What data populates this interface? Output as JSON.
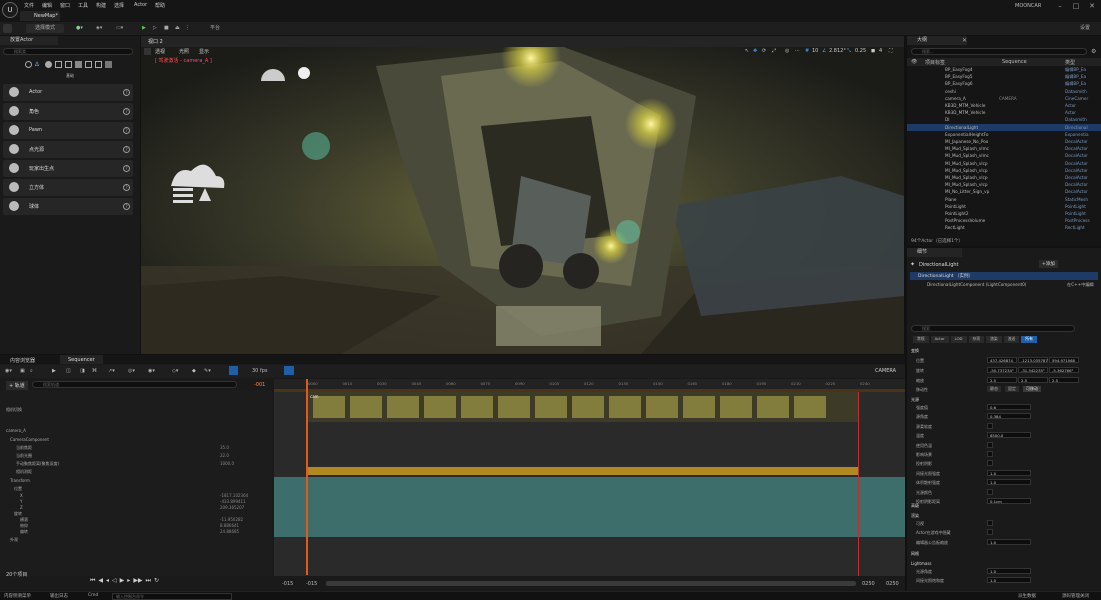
{
  "app": {
    "logo": "U",
    "map_tab": "NewMap*",
    "project": "MOONCAR"
  },
  "menu": [
    "文件",
    "编辑",
    "窗口",
    "工具",
    "构建",
    "选择",
    "Actor",
    "帮助"
  ],
  "toolbar": {
    "mode": "选择模式",
    "platform": "平台",
    "settings": "设置"
  },
  "left_panel": {
    "tab": "放置Actor",
    "search_placeholder": "搜索类",
    "category_label": "基础",
    "items": [
      "Actor",
      "角色",
      "Pawn",
      "点光源",
      "玩家出生点",
      "立方体",
      "球体"
    ]
  },
  "viewport": {
    "tab": "视口 2",
    "view_mode": "透视",
    "lighting": "光照",
    "show": "显示",
    "pilot_label": "[ 驾驶激活 - camera_A ]",
    "fov": "2.812°",
    "speed": "0.25",
    "grid": "10",
    "cam_index": "4"
  },
  "outliner": {
    "tab": "大纲",
    "search_placeholder": "搜索...",
    "col_item": "项目标签",
    "col_seq": "Sequence",
    "col_type": "类型",
    "rows": [
      {
        "name": "BP_EasyFog4",
        "type": "编辑BP_Ea"
      },
      {
        "name": "BP_EasyFog5",
        "type": "编辑BP_Ea"
      },
      {
        "name": "BP_EasyFog6",
        "type": "编辑BP_Ea"
      },
      {
        "name": "ceshi",
        "type": "Datasmith"
      },
      {
        "name": "camera_A",
        "type": "CineCamer",
        "seq": "CAMERA"
      },
      {
        "name": "KB3D_MTM_Vehicle",
        "type": "Actor"
      },
      {
        "name": "KB3D_MTM_Vehicle",
        "type": "Actor"
      },
      {
        "name": "DI",
        "type": "Datasmith"
      },
      {
        "name": "DirectionalLight",
        "type": "Directional"
      },
      {
        "name": "ExponentialHeightFo",
        "type": "Exponentia"
      },
      {
        "name": "MI_Japanese_No_Poo",
        "type": "DecalActor"
      },
      {
        "name": "MI_Mud_Splash_vlmc",
        "type": "DecalActor"
      },
      {
        "name": "MI_Mud_Splash_vlmc",
        "type": "DecalActor"
      },
      {
        "name": "MI_Mud_Splash_vlcp",
        "type": "DecalActor"
      },
      {
        "name": "MI_Mud_Splash_vlcp",
        "type": "DecalActor"
      },
      {
        "name": "MI_Mud_Splash_vlcp",
        "type": "DecalActor"
      },
      {
        "name": "MI_Mud_Splash_vlcp",
        "type": "DecalActor"
      },
      {
        "name": "MI_No_Litter_Sign_vp",
        "type": "DecalActor"
      },
      {
        "name": "Plane",
        "type": "StaticMesh"
      },
      {
        "name": "PointLight",
        "type": "PointLight"
      },
      {
        "name": "PointLight2",
        "type": "PointLight"
      },
      {
        "name": "PostProcessVolume",
        "type": "PostProcess"
      },
      {
        "name": "RectLight",
        "type": "RectLight"
      }
    ],
    "footer": "94个Actor（已选择1个）"
  },
  "details": {
    "tab": "细节",
    "actor": "DirectionalLight",
    "add_button": "+添加",
    "comp_root": "DirectionalLight （实例）",
    "comp_child": "DirectionalLightComponent (LightComponent0)",
    "edit_cpp": "在C++中编辑",
    "search_placeholder": "搜索",
    "filter_tabs": [
      "常规",
      "Actor",
      "LOD",
      "杂项",
      "渲染",
      "流送",
      "所有"
    ],
    "section_transform": "变换",
    "location": {
      "label": "位置",
      "x": "437.426874",
      "y": "-1213.035787",
      "z": "594.971068"
    },
    "rotation": {
      "label": "旋转",
      "x": "-50.737234°",
      "y": "-31.342235°",
      "z": "-5.362766°"
    },
    "scale": {
      "label": "缩放",
      "x": "2.5",
      "y": "2.5",
      "z": "2.5"
    },
    "mobility": {
      "label": "移动性",
      "a": "静态",
      "b": "固定",
      "c": "可移动"
    },
    "section_light": "光源",
    "light_props": [
      {
        "label": "强度值",
        "value": "0.6"
      },
      {
        "label": "源角度",
        "value": "0.384"
      },
      {
        "label": "源柔软度",
        "value": ""
      },
      {
        "label": "温度",
        "value": "6500.0"
      },
      {
        "label": "使用色温",
        "value": ""
      },
      {
        "label": "影响场景",
        "value": ""
      },
      {
        "label": "投射阴影",
        "value": ""
      },
      {
        "label": "间接光照强度",
        "value": "1.0"
      },
      {
        "label": "体积散射强度",
        "value": "1.0"
      },
      {
        "label": "光源颜色",
        "value": ""
      },
      {
        "label": "投射阴影距离",
        "value": "0.1cm"
      }
    ],
    "section_render": "渲染",
    "render_props": [
      {
        "label": "可视",
        "value": ""
      },
      {
        "label": "Actor在游戏中隐藏",
        "value": ""
      },
      {
        "label": "编辑器公告板缩放",
        "value": "1.0"
      }
    ],
    "section_lightmass": "Lightmass",
    "lightmass_props": [
      {
        "label": "光源角度",
        "value": "1.0"
      },
      {
        "label": "间接光照饱和度",
        "value": "1.0"
      }
    ],
    "section_physics": "高级",
    "section_anim": "网格"
  },
  "sequencer": {
    "tab_content": "内容浏览器",
    "tab_seq": "Sequencer",
    "fps": "30 fps",
    "track_button": "+ 轨道",
    "search_placeholder": "搜索轨道",
    "current_frame": "-001",
    "camera_dropdown": "CAMERA",
    "tracks": [
      "相机切换",
      "camera_A",
      "CameraComponent",
      "当前焦距",
      "当前光圈",
      "手动聚焦距离(聚焦深度)",
      "相机测距",
      "Transform",
      "位置",
      "X",
      "Y",
      "Z",
      "旋转",
      "横滚",
      "俯仰",
      "偏转",
      "外观"
    ],
    "values": {
      "focal": "35.0",
      "aperture": "22.0",
      "focus": "1000.0",
      "x": "-1817.102364",
      "y": "-433.899411",
      "z": "209.365207",
      "roll": "-11.950282",
      "pitch": "8.886641",
      "yaw": "24.88685"
    },
    "item_count": "20个项目",
    "range_left": "-015",
    "range_left2": "-015",
    "range_right": "0250",
    "range_right2": "0250",
    "ticks": [
      "0000",
      "0015",
      "0030",
      "0045",
      "0060",
      "0075",
      "0090",
      "0105",
      "0120",
      "0135",
      "0150",
      "0165",
      "0180",
      "0195",
      "0210",
      "0225",
      "0240"
    ],
    "section_label": "cam"
  },
  "status": {
    "content": "内容侧滑菜单",
    "output": "输出日志",
    "cmd": "Cmd",
    "cmd_placeholder": "输入控制台命令",
    "derived": "派生数据",
    "source": "源码管理关闭"
  }
}
